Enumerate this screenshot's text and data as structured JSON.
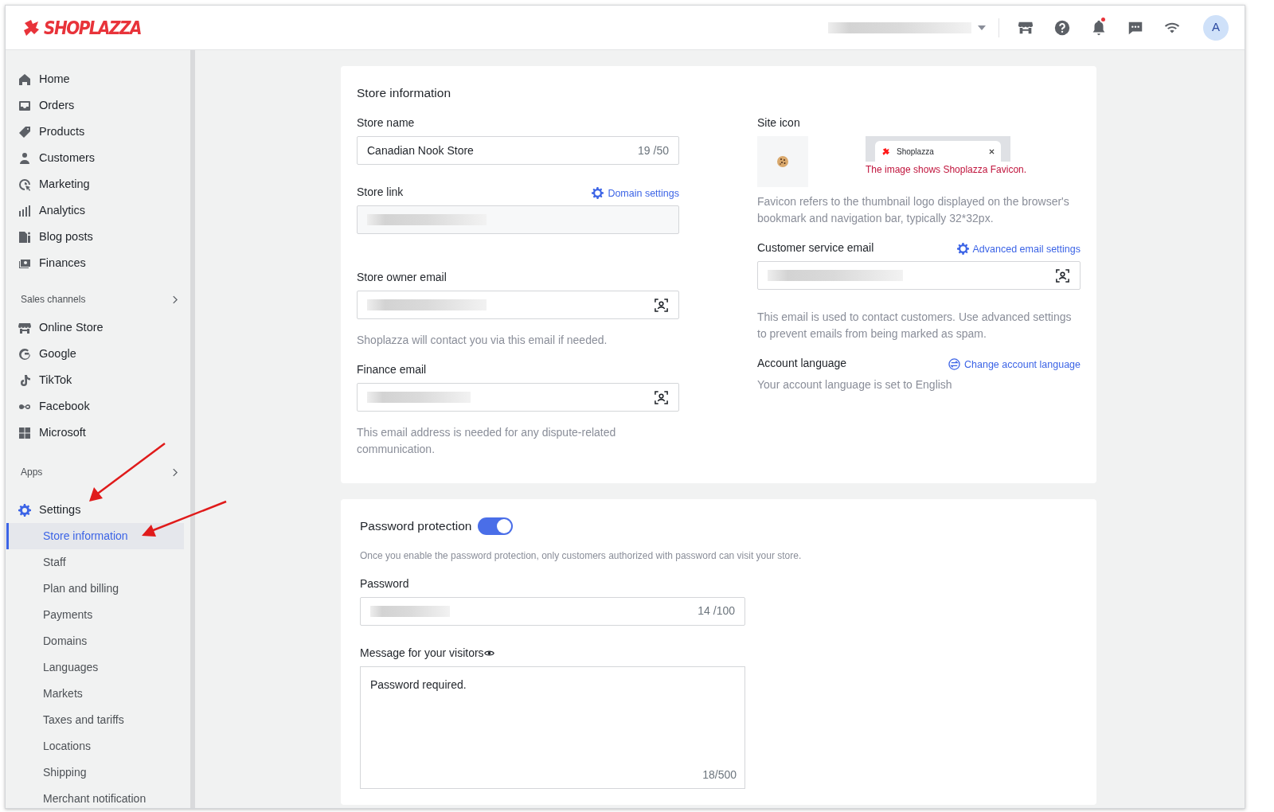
{
  "header": {
    "logo": "SHOPLAZZA",
    "avatar": "A",
    "notification_dot": true
  },
  "sidebar": {
    "main": [
      {
        "label": "Home"
      },
      {
        "label": "Orders"
      },
      {
        "label": "Products"
      },
      {
        "label": "Customers"
      },
      {
        "label": "Marketing"
      },
      {
        "label": "Analytics"
      },
      {
        "label": "Blog posts"
      },
      {
        "label": "Finances"
      }
    ],
    "sales_channels": {
      "title": "Sales channels",
      "items": [
        {
          "label": "Online Store"
        },
        {
          "label": "Google"
        },
        {
          "label": "TikTok"
        },
        {
          "label": "Facebook"
        },
        {
          "label": "Microsoft"
        }
      ]
    },
    "apps": {
      "title": "Apps"
    },
    "settings": {
      "label": "Settings",
      "children": [
        {
          "label": "Store information",
          "selected": true
        },
        {
          "label": "Staff",
          "selected": false
        },
        {
          "label": "Plan and billing",
          "selected": false
        },
        {
          "label": "Payments",
          "selected": false
        },
        {
          "label": "Domains",
          "selected": false
        },
        {
          "label": "Languages",
          "selected": false
        },
        {
          "label": "Markets",
          "selected": false
        },
        {
          "label": "Taxes and tariffs",
          "selected": false
        },
        {
          "label": "Locations",
          "selected": false
        },
        {
          "label": "Shipping",
          "selected": false
        },
        {
          "label": "Merchant notification",
          "selected": false
        }
      ]
    }
  },
  "store_information": {
    "title": "Store information",
    "store_name": {
      "label": "Store name",
      "value": "Canadian Nook Store",
      "count": "19 /50"
    },
    "store_link": {
      "label": "Store link",
      "link": "Domain settings"
    },
    "owner_email": {
      "label": "Store owner email",
      "help": "Shoplazza will contact you via this email if needed."
    },
    "finance_email": {
      "label": "Finance email",
      "help": "This email address is needed for any dispute-related communication."
    },
    "site_icon": {
      "label": "Site icon",
      "tab_title": "Shoplazza",
      "annotation": "The image shows Shoplazza Favicon.",
      "help": "Favicon refers to the thumbnail logo displayed on the browser's bookmark and navigation bar, typically 32*32px."
    },
    "service_email": {
      "label": "Customer service email",
      "link": "Advanced email settings",
      "help": "This email is used to contact customers. Use advanced settings to prevent emails from being marked as spam."
    },
    "account_language": {
      "label": "Account language",
      "link": "Change account language",
      "help": "Your account language is set to English"
    }
  },
  "password_protection": {
    "title": "Password protection",
    "on": true,
    "help": "Once you enable the password protection, only customers authorized with password can visit your store.",
    "password": {
      "label": "Password",
      "count": "14 /100"
    },
    "message": {
      "label": "Message for your visitors",
      "value": "Password required.",
      "count": "18/500"
    }
  }
}
